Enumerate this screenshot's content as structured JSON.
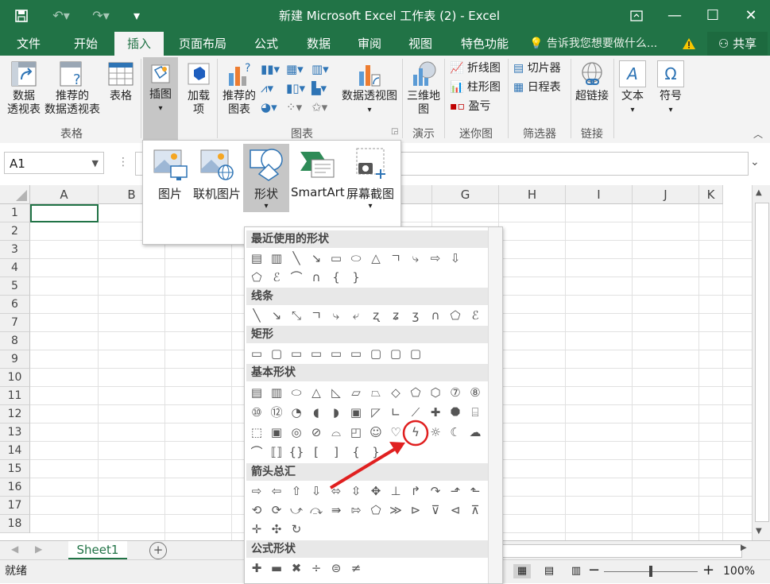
{
  "window": {
    "title": "新建 Microsoft Excel 工作表 (2) - Excel",
    "save_icon": "save-icon",
    "undo_icon": "undo-icon",
    "redo_icon": "redo-icon"
  },
  "tabs": [
    {
      "label": "文件"
    },
    {
      "label": "开始"
    },
    {
      "label": "插入"
    },
    {
      "label": "页面布局"
    },
    {
      "label": "公式"
    },
    {
      "label": "数据"
    },
    {
      "label": "审阅"
    },
    {
      "label": "视图"
    },
    {
      "label": "特色功能"
    }
  ],
  "tell_me": "告诉我您想要做什么...",
  "share": "共享",
  "ribbon": {
    "table_group": {
      "label": "表格",
      "pivot": "数据\n透视表",
      "recommended_pivot": "推荐的\n数据透视表",
      "table": "表格"
    },
    "illustrations": "插图",
    "addins": "加载\n项",
    "charts_group": {
      "label": "图表",
      "recommended": "推荐的\n图表",
      "pivot_chart": "数据透视图"
    },
    "tour_group": {
      "label": "演示",
      "map3d": "三维地\n图"
    },
    "sparklines_group": {
      "label": "迷你图",
      "line": "折线图",
      "column": "柱形图",
      "winloss": "盈亏"
    },
    "filters_group": {
      "label": "筛选器",
      "slicer": "切片器",
      "timeline": "日程表"
    },
    "links_group": {
      "label": "链接",
      "hyperlink": "超链接"
    },
    "text": "文本",
    "symbols": "符号"
  },
  "namebox": "A1",
  "columns": [
    "A",
    "B",
    "C",
    "D",
    "E",
    "F",
    "G",
    "H",
    "I",
    "J",
    "K"
  ],
  "rows": [
    "1",
    "2",
    "3",
    "4",
    "5",
    "6",
    "7",
    "8",
    "9",
    "10",
    "11",
    "12",
    "13",
    "14",
    "15",
    "16",
    "17",
    "18"
  ],
  "illustrations_menu": {
    "picture": "图片",
    "online_picture": "联机图片",
    "shapes": "形状",
    "smartart": "SmartArt",
    "screenshot": "屏幕截图"
  },
  "shapes_gallery": {
    "recent": "最近使用的形状",
    "lines": "线条",
    "rectangles": "矩形",
    "basic": "基本形状",
    "arrows": "箭头总汇",
    "equation": "公式形状"
  },
  "sheet_tab": "Sheet1",
  "status": "就绪",
  "zoom": "100%",
  "colors": {
    "excel_green": "#217346",
    "annotation_red": "#e02020"
  }
}
